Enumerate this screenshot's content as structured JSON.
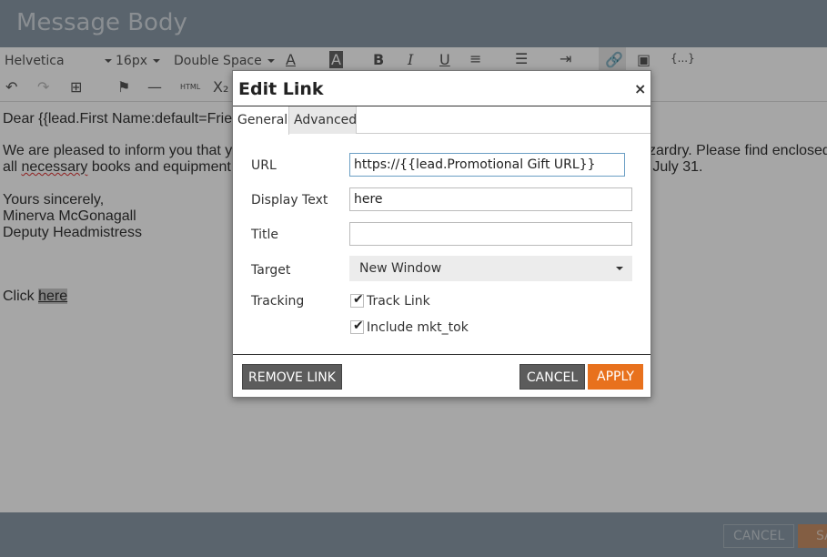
{
  "header": {
    "title": "Message Body"
  },
  "toolbar": {
    "font_family": "Helvetica",
    "font_size": "16px",
    "line_spacing": "Double Space",
    "html_label": "HTML",
    "tokens_label": "{...}"
  },
  "editor": {
    "line1": "Dear {{lead.First Name:default=Frie",
    "line2a": "We are pleased to inform you that y",
    "line2b": "zardry. Please find enclosed",
    "line3a": "all ",
    "line3b": "necessary",
    "line3c": " books and equipment.",
    "line3d": "n July 31.",
    "line4": "Yours sincerely,",
    "line5": "Minerva McGonagall",
    "line6": "Deputy Headmistress",
    "line7a": "Click ",
    "line7b": "here"
  },
  "footer": {
    "cancel_label": "CANCEL",
    "save_label": "SA"
  },
  "dialog": {
    "title": "Edit Link",
    "close": "×",
    "tabs": [
      {
        "label": "General"
      },
      {
        "label": "Advanced"
      }
    ],
    "url_label": "URL",
    "url_value": "https://{{lead.Promotional Gift URL}}",
    "display_text_label": "Display Text",
    "display_text_value": "here",
    "title_label": "Title",
    "title_value": "",
    "target_label": "Target",
    "target_value": "New Window",
    "tracking_label": "Tracking",
    "track_link_label": "Track Link",
    "include_token_label": "Include mkt_tok",
    "remove_label": "REMOVE LINK",
    "cancel_label": "CANCEL",
    "apply_label": "APPLY"
  }
}
